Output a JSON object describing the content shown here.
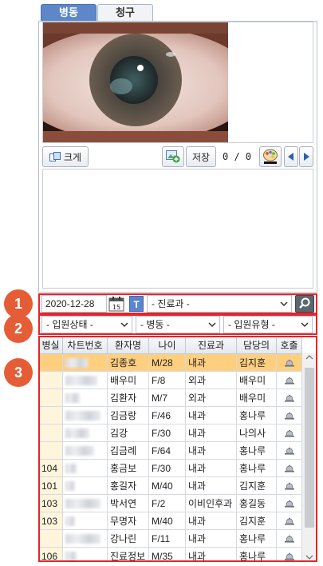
{
  "tabs": [
    {
      "label": "병동",
      "active": true
    },
    {
      "label": "청구",
      "active": false
    }
  ],
  "toolbar": {
    "enlarge_label": "크게",
    "save_label": "저장",
    "counter": "0 /  0"
  },
  "filters": {
    "date": "2020-12-28",
    "t_label": "T",
    "department": "- 진료과 -",
    "admission_status": "- 입원상태 -",
    "ward": "- 병동 -",
    "admission_type": "- 입원유형 -"
  },
  "callouts": [
    "1",
    "2",
    "3"
  ],
  "table": {
    "columns": [
      "병실",
      "차트번호",
      "환자명",
      "나이",
      "진료과",
      "담당의",
      "호출"
    ],
    "rows": [
      {
        "room": "",
        "name": "김종호",
        "age": "M/28",
        "dept": "내과",
        "doctor": "김지훈",
        "selected": true
      },
      {
        "room": "",
        "name": "배우미",
        "age": "F/8",
        "dept": "외과",
        "doctor": "배우미"
      },
      {
        "room": "",
        "name": "김환자",
        "age": "M/7",
        "dept": "외과",
        "doctor": "배우미"
      },
      {
        "room": "",
        "name": "김금랑",
        "age": "F/46",
        "dept": "내과",
        "doctor": "홍나루"
      },
      {
        "room": "",
        "name": "김강",
        "age": "F/30",
        "dept": "내과",
        "doctor": "나의사"
      },
      {
        "room": "",
        "name": "김금례",
        "age": "F/64",
        "dept": "내과",
        "doctor": "홍나루"
      },
      {
        "room": "104",
        "name": "홍금보",
        "age": "F/30",
        "dept": "내과",
        "doctor": "홍나루"
      },
      {
        "room": "101",
        "name": "홍길자",
        "age": "M/40",
        "dept": "내과",
        "doctor": "김지훈"
      },
      {
        "room": "103",
        "name": "박서연",
        "age": "F/2",
        "dept": "이비인후과",
        "doctor": "홍길동"
      },
      {
        "room": "103",
        "name": "무명자",
        "age": "M/40",
        "dept": "내과",
        "doctor": "김지훈"
      },
      {
        "room": "",
        "name": "강나린",
        "age": "F/11",
        "dept": "내과",
        "doctor": "홍나루"
      },
      {
        "room": "106",
        "name": "진료정보",
        "age": "M/35",
        "dept": "내과",
        "doctor": "홍나루"
      }
    ]
  },
  "colors": {
    "tab_active": "#5d87c9",
    "selected_row": "#ffcf80",
    "callout": "#e55d37",
    "highlight_box": "#e5242b"
  }
}
